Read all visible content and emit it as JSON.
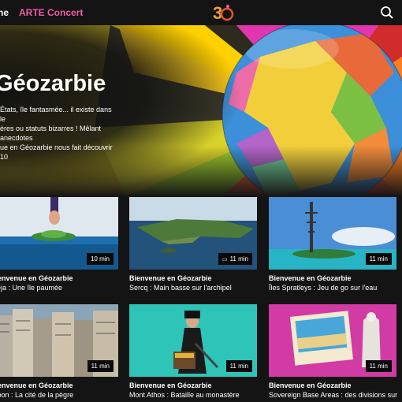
{
  "nav": {
    "item_1": "ne",
    "item_2": "ARTE Concert"
  },
  "hero": {
    "title": "Géozarbie",
    "description": "États, île fantasmée... il existe dans le\nères ou statuts bizarres ! Mêlant anecdotes\nue en Géozarbie nous fait découvrir 10"
  },
  "icons": {
    "logo": "arte-30-logo",
    "search": "search-icon",
    "subtitles": "subtitles-icon"
  },
  "colors": {
    "accent": "#f05aa6",
    "background": "#141414"
  },
  "cards": [
    {
      "series": "Bienvenue en Géozarbie",
      "title": "rnejа : Une île paumée",
      "duration": "10 min",
      "has_cc": false
    },
    {
      "series": "Bienvenue en Géozarbie",
      "title": "Sercq : Main basse sur l'archipel",
      "duration": "11 min",
      "has_cc": true
    },
    {
      "series": "Bienvenue en Géozarbie",
      "title": "Îles Spratleys : Jeu de go sur l'eau",
      "duration": "11 min",
      "has_cc": false
    },
    {
      "series": "Bienvenue en Géozarbie",
      "title": "wloon : La cité de la pègre",
      "duration": "11 min",
      "has_cc": false
    },
    {
      "series": "Bienvenue en Géozarbie",
      "title": "Mont Athos : Bataille au monastère",
      "duration": "11 min",
      "has_cc": false
    },
    {
      "series": "Bienvenue en Géozarbie",
      "title": "Sovereign Base Areas : des divisions sur",
      "duration": "11 min",
      "has_cc": false
    }
  ]
}
